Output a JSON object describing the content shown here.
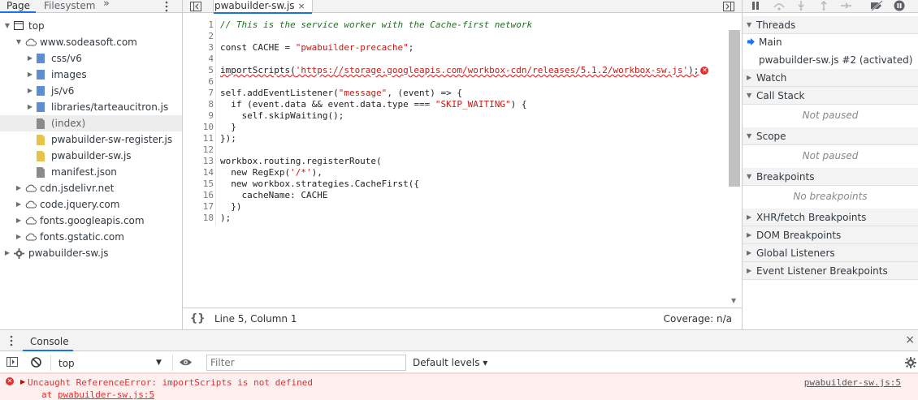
{
  "navigator": {
    "tabs": {
      "page": "Page",
      "filesystem": "Filesystem",
      "more": "»"
    },
    "tree": [
      {
        "label": "top",
        "icon": "frame-icon",
        "expanded": true
      },
      {
        "label": "www.sodeasoft.com",
        "icon": "cloud-icon",
        "expanded": true
      },
      {
        "label": "css/v6",
        "icon": "folder-icon",
        "expanded": false
      },
      {
        "label": "images",
        "icon": "folder-icon",
        "expanded": false
      },
      {
        "label": "js/v6",
        "icon": "folder-icon",
        "expanded": false
      },
      {
        "label": "libraries/tarteaucitron.js",
        "icon": "folder-icon",
        "expanded": false
      },
      {
        "label": "(index)",
        "icon": "file-icon",
        "selected": true
      },
      {
        "label": "pwabuilder-sw-register.js",
        "icon": "js-file-icon"
      },
      {
        "label": "pwabuilder-sw.js",
        "icon": "js-file-icon"
      },
      {
        "label": "manifest.json",
        "icon": "file-icon"
      },
      {
        "label": "cdn.jsdelivr.net",
        "icon": "cloud-icon",
        "expanded": false
      },
      {
        "label": "code.jquery.com",
        "icon": "cloud-icon",
        "expanded": false
      },
      {
        "label": "fonts.googleapis.com",
        "icon": "cloud-icon",
        "expanded": false
      },
      {
        "label": "fonts.gstatic.com",
        "icon": "cloud-icon",
        "expanded": false
      },
      {
        "label": "pwabuilder-sw.js",
        "icon": "gear-icon",
        "expanded": false
      }
    ]
  },
  "editor": {
    "tab_label": "pwabuilder-sw.js",
    "tab_close": "×",
    "line_numbers": [
      "1",
      "2",
      "3",
      "4",
      "5",
      "6",
      "7",
      "8",
      "9",
      "10",
      "11",
      "12",
      "13",
      "14",
      "15",
      "16",
      "17",
      "18"
    ],
    "lines": [
      "// This is the service worker with the Cache-first network",
      "",
      "const CACHE = \"pwabuilder-precache\";",
      "",
      "importScripts('https://storage.googleapis.com/workbox-cdn/releases/5.1.2/workbox-sw.js');",
      "",
      "self.addEventListener(\"message\", (event) => {",
      "  if (event.data && event.data.type === \"SKIP_WAITING\") {",
      "    self.skipWaiting();",
      "  }",
      "});",
      "",
      "workbox.routing.registerRoute(",
      "  new RegExp('/*'),",
      "  new workbox.strategies.CacheFirst({",
      "    cacheName: CACHE",
      "  })",
      ");"
    ],
    "error_line": 5,
    "error_marker": "✕",
    "status": {
      "pretty_print": "{}",
      "position": "Line 5, Column 1",
      "coverage": "Coverage: n/a"
    }
  },
  "sidebar": {
    "threads": {
      "title": "Threads",
      "main": "Main",
      "worker": "pwabuilder-sw.js #2 (activated)"
    },
    "watch": "Watch",
    "call_stack": {
      "title": "Call Stack",
      "empty": "Not paused"
    },
    "scope": {
      "title": "Scope",
      "empty": "Not paused"
    },
    "breakpoints": {
      "title": "Breakpoints",
      "empty": "No breakpoints"
    },
    "xhr": "XHR/fetch Breakpoints",
    "dom": "DOM Breakpoints",
    "global": "Global Listeners",
    "event": "Event Listener Breakpoints"
  },
  "console": {
    "tab_label": "Console",
    "close": "×",
    "context": "top",
    "filter_placeholder": "Filter",
    "levels": "Default levels ▾",
    "message": {
      "icon": "✕",
      "text": "Uncaught ReferenceError: importScripts is not defined",
      "at_prefix": "at ",
      "at_link": "pwabuilder-sw.js:5",
      "source": "pwabuilder-sw.js:5"
    }
  },
  "colors": {
    "accent": "#1a73e8",
    "error": "#e03030",
    "error_bg": "#fff0f0"
  }
}
